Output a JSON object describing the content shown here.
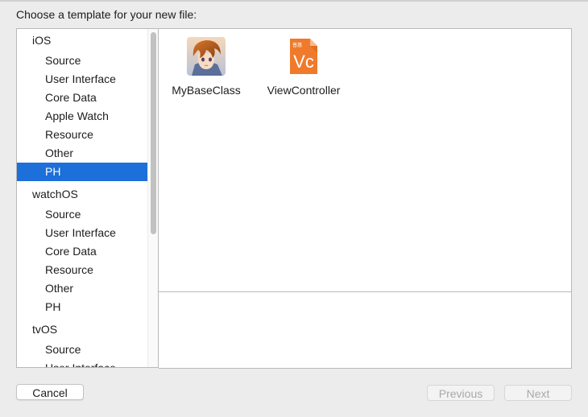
{
  "dialog": {
    "title": "Choose a template for your new file:"
  },
  "sidebar": {
    "groups": [
      {
        "name": "iOS",
        "items": [
          "Source",
          "User Interface",
          "Core Data",
          "Apple Watch",
          "Resource",
          "Other",
          "PH"
        ]
      },
      {
        "name": "watchOS",
        "items": [
          "Source",
          "User Interface",
          "Core Data",
          "Resource",
          "Other",
          "PH"
        ]
      },
      {
        "name": "tvOS",
        "items": [
          "Source",
          "User Interface"
        ]
      }
    ],
    "selected": "iOS / PH"
  },
  "templates": [
    {
      "label": "MyBaseClass",
      "icon": "anime-avatar-icon"
    },
    {
      "label": "ViewController",
      "icon": "vc-file-icon",
      "icon_text": "Vc",
      "icon_badge": "普惠"
    }
  ],
  "buttons": {
    "cancel": "Cancel",
    "previous": "Previous",
    "next": "Next"
  },
  "colors": {
    "selection": "#1d6fd9",
    "vc_icon": "#f07a2b"
  }
}
